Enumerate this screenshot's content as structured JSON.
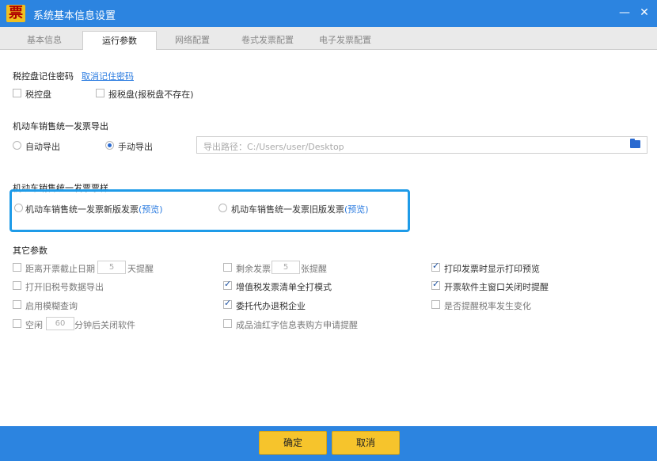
{
  "window": {
    "app_icon_glyph": "票",
    "title": "系统基本信息设置",
    "minimize_glyph": "—",
    "close_glyph": "✕"
  },
  "tabs": [
    {
      "label": "基本信息",
      "active": false
    },
    {
      "label": "运行参数",
      "active": true
    },
    {
      "label": "网络配置",
      "active": false
    },
    {
      "label": "卷式发票配置",
      "active": false
    },
    {
      "label": "电子发票配置",
      "active": false
    }
  ],
  "password": {
    "title": "税控盘记住密码",
    "clear_link": "取消记住密码",
    "opt1": {
      "label": "税控盘",
      "checked": false
    },
    "opt2": {
      "label": "报税盘(报税盘不存在)",
      "checked": false
    }
  },
  "export": {
    "title": "机动车销售统一发票导出",
    "auto": {
      "label": "自动导出",
      "checked": false
    },
    "manual": {
      "label": "手动导出",
      "checked": true
    },
    "path": "导出路径：C:/Users/user/Desktop",
    "folder_icon": "folder-icon"
  },
  "style": {
    "title": "机动车销售统一发票票样",
    "new": {
      "label": "机动车销售统一发票新版发票",
      "preview": "(预览)",
      "checked": false
    },
    "old": {
      "label": "机动车销售统一发票旧版发票",
      "preview": "(预览)",
      "checked": false
    }
  },
  "other": {
    "title": "其它参数",
    "items": [
      {
        "pre": "距离开票截止日期",
        "value": "5",
        "post": "天提醒",
        "checked": false
      },
      {
        "label": "打开旧税号数据导出",
        "checked": false
      },
      {
        "label": "启用模糊查询",
        "checked": false
      },
      {
        "pre": "空闲",
        "value": "60",
        "post": "分钟后关闭软件",
        "checked": false
      },
      {
        "pre": "剩余发票",
        "value": "5",
        "post": "张提醒",
        "checked": false
      },
      {
        "label": "增值税发票清单全打模式",
        "checked": true
      },
      {
        "label": "委托代办退税企业",
        "checked": true
      },
      {
        "label": "成品油红字信息表购方申请提醒",
        "checked": false
      },
      {
        "label": "打印发票时显示打印预览",
        "checked": true
      },
      {
        "label": "开票软件主窗口关闭时提醒",
        "checked": true
      },
      {
        "label": "是否提醒税率发生变化",
        "checked": false
      }
    ]
  },
  "footer": {
    "ok": "确定",
    "cancel": "取消"
  },
  "colors": {
    "titlebar": "#2c84e0",
    "accent": "#2a7be0",
    "highlight_border": "#1e9be8",
    "button": "#f6c42c"
  }
}
